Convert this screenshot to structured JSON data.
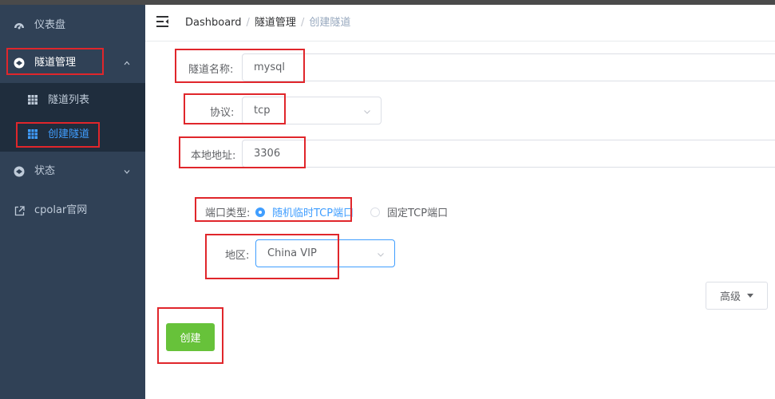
{
  "sidebar": {
    "items": [
      {
        "label": "仪表盘",
        "icon": "dashboard-icon"
      },
      {
        "label": "隧道管理",
        "icon": "tunnel-icon"
      },
      {
        "label": "状态",
        "icon": "status-icon"
      },
      {
        "label": "cpolar官网",
        "icon": "external-link-icon"
      }
    ],
    "subitems": [
      {
        "label": "隧道列表",
        "icon": "grid-icon"
      },
      {
        "label": "创建隧道",
        "icon": "grid-icon"
      }
    ]
  },
  "header": {
    "breadcrumb": [
      "Dashboard",
      "隧道管理",
      "创建隧道"
    ],
    "separator": "/"
  },
  "form": {
    "name": {
      "label": "隧道名称:",
      "value": "mysql"
    },
    "protocol": {
      "label": "协议:",
      "value": "tcp"
    },
    "local_addr": {
      "label": "本地地址:",
      "value": "3306"
    },
    "port_type": {
      "label": "端口类型:",
      "options": [
        "随机临时TCP端口",
        "固定TCP端口"
      ],
      "selected": "随机临时TCP端口"
    },
    "region": {
      "label": "地区:",
      "value": "China VIP"
    },
    "advanced_label": "高级",
    "create_label": "创建"
  },
  "colors": {
    "sidebar_bg": "#304156",
    "submenu_bg": "#1f2d3d",
    "accent": "#409eff",
    "create_button": "#67c23a",
    "highlight_box": "#e0262b"
  }
}
